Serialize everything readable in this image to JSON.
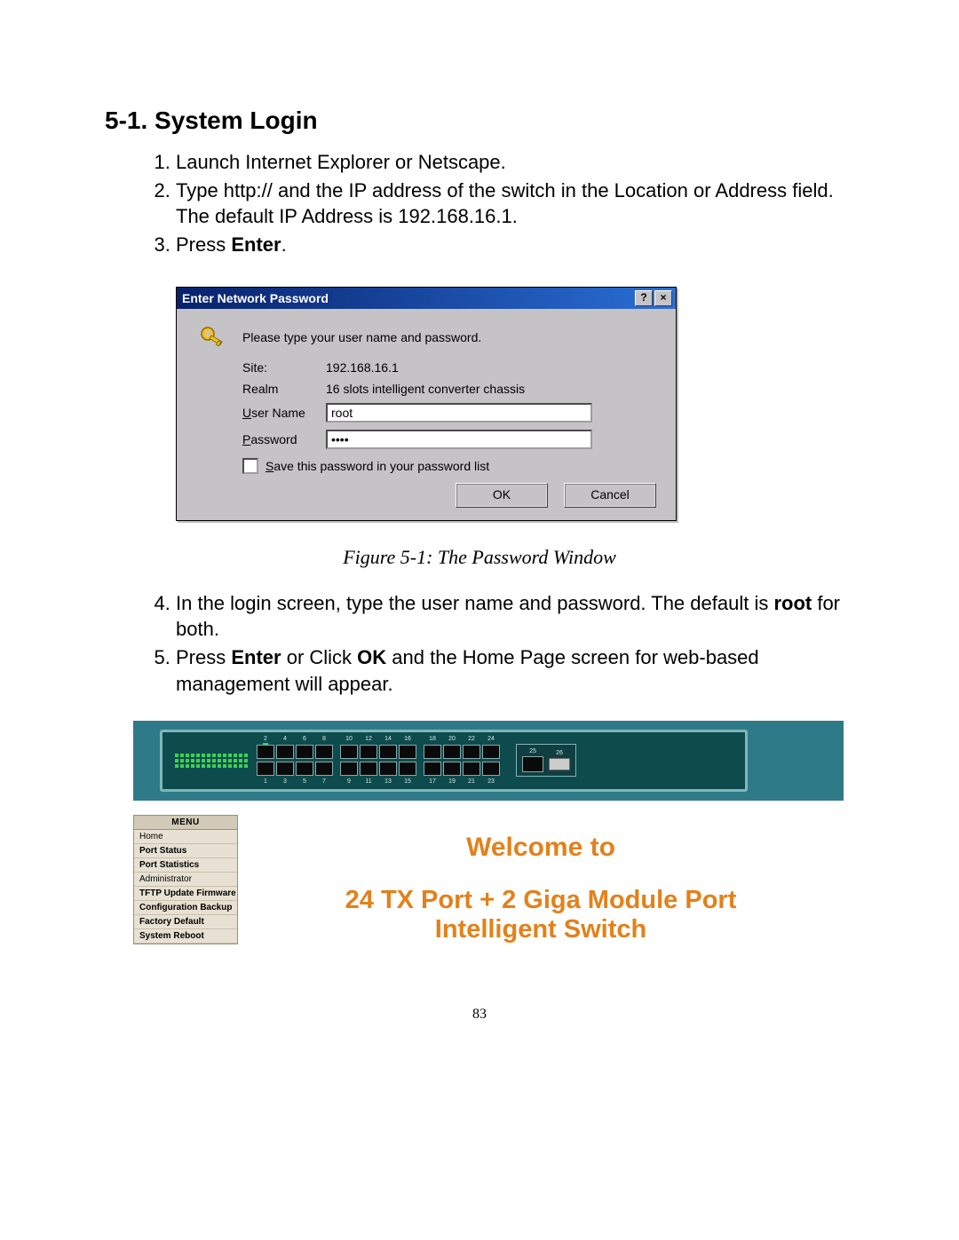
{
  "heading": "5-1. System Login",
  "steps_a": [
    "Launch Internet Explorer or Netscape.",
    "Type http:// and the IP address of the switch in the Location or Address field.  The default IP Address is 192.168.16.1."
  ],
  "step3_prefix": "Press ",
  "step3_bold": "Enter",
  "step3_suffix": ".",
  "dialog": {
    "title": "Enter Network Password",
    "help": "?",
    "close": "×",
    "prompt": "Please type your user name and password.",
    "labels": {
      "site": "Site:",
      "realm": "Realm",
      "user_u": "U",
      "user_rest": "ser Name",
      "pass_u": "P",
      "pass_rest": "assword"
    },
    "site_value": "192.168.16.1",
    "realm_value": "16 slots intelligent converter chassis",
    "user_value": "root",
    "pass_value": "****",
    "save_u": "S",
    "save_rest": "ave this password in your password list",
    "ok": "OK",
    "cancel": "Cancel"
  },
  "figure_caption": "Figure 5-1: The Password Window",
  "step4_prefix": "In the login screen, type the user name and password. The default is ",
  "step4_bold": "root",
  "step4_suffix": " for both.",
  "step5_a": "Press ",
  "step5_b": "Enter",
  "step5_c": " or Click ",
  "step5_d": "OK",
  "step5_e": " and the Home Page screen for web-based management will appear.",
  "menu_header": "MENU",
  "menu_items": [
    {
      "label": "Home",
      "bold": false
    },
    {
      "label": "Port Status",
      "bold": true
    },
    {
      "label": "Port Statistics",
      "bold": true
    },
    {
      "label": "Administrator",
      "bold": false
    },
    {
      "label": "TFTP Update Firmware",
      "bold": true
    },
    {
      "label": "Configuration Backup",
      "bold": true
    },
    {
      "label": "Factory Default",
      "bold": true
    },
    {
      "label": "System Reboot",
      "bold": true
    }
  ],
  "port_top_nums": [
    "2",
    "4",
    "6",
    "8",
    "10",
    "12",
    "14",
    "16",
    "18",
    "20",
    "22",
    "24"
  ],
  "port_bot_nums": [
    "1",
    "3",
    "5",
    "7",
    "9",
    "11",
    "13",
    "15",
    "17",
    "19",
    "21",
    "23"
  ],
  "giga_nums": [
    "25",
    "26"
  ],
  "welcome_l1": "Welcome to",
  "welcome_l2a": "24 TX Port + 2 Giga Module Port",
  "welcome_l2b": "Intelligent Switch",
  "page_number": "83"
}
